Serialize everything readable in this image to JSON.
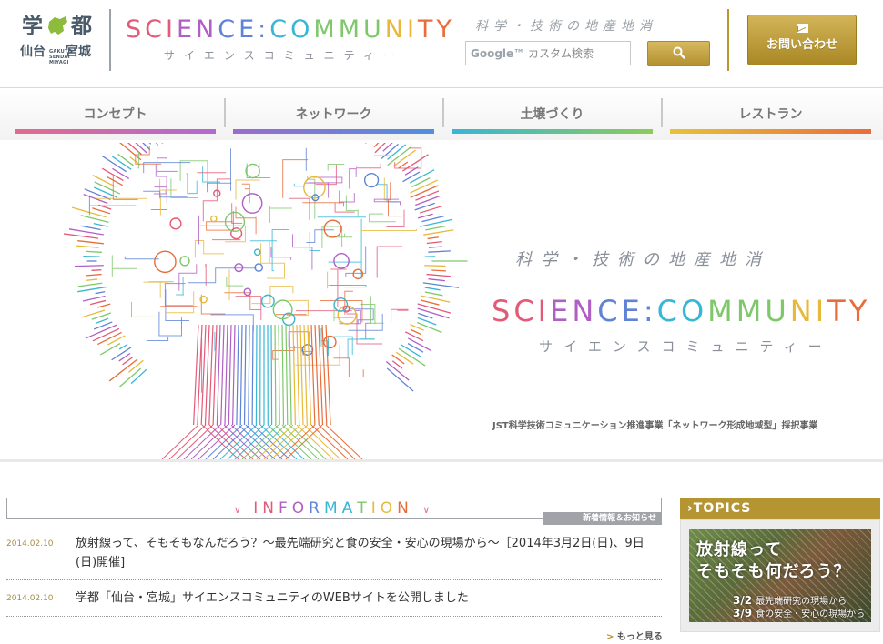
{
  "header": {
    "logo": {
      "big_left": "学",
      "big_right": "都",
      "small_left": "仙台",
      "small_right": "宮城",
      "roman": [
        "GAKUTO",
        "SENDAI",
        "MIYAGI"
      ]
    },
    "brand": {
      "main": "SCIENCE:COMMUNITY",
      "sub": "サイエンスコミュニティー"
    },
    "tagline": "科学・技術の地産地消",
    "search": {
      "google_label": "Google™",
      "placeholder": "カスタム検索"
    },
    "contact_label": "お問い合わせ"
  },
  "nav": {
    "items": [
      {
        "label": "コンセプト"
      },
      {
        "label": "ネットワーク"
      },
      {
        "label": "土壌づくり"
      },
      {
        "label": "レストラン"
      }
    ]
  },
  "hero": {
    "tagline": "科学・技術の地産地消",
    "logo_main": "SCIENCE:COMMUNITY",
    "logo_sub": "サイエンスコミュニティー",
    "caption": "JST科学技術コミュニケーション推進事業「ネットワーク形成地域型」採択事業"
  },
  "information": {
    "title": "INFORMATION",
    "subtitle": "新着情報＆お知らせ",
    "news": [
      {
        "date": "2014.02.10",
        "text": "放射線って、そもそもなんだろう？～最先端研究と食の安全・安心の現場から～［2014年3月2日(日)、9日(日)開催]"
      },
      {
        "date": "2014.02.10",
        "text": "学都「仙台・宮城」サイエンスコミュニティのWEBサイトを公開しました"
      }
    ],
    "more_label": "もっと見る"
  },
  "topics": {
    "title": "TOPICS",
    "banner": {
      "line1": "放射線って",
      "line2": "そもそも何だろう？",
      "date1": "3/2",
      "desc1": "最先端研究の現場から",
      "date2": "3/9",
      "desc2": "食の安全・安心の現場から"
    }
  },
  "colors": {
    "gold": "#b49532",
    "gray_text": "#8a8f9a",
    "rainbow": [
      "#e35a78",
      "#b05fc4",
      "#5f83d6",
      "#38b6d6",
      "#7ec86b",
      "#e8b83a",
      "#e86d3a"
    ]
  }
}
